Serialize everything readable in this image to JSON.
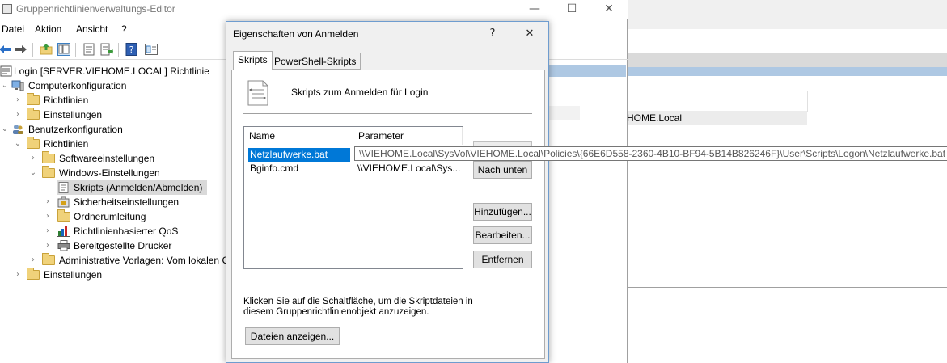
{
  "window": {
    "title": "Gruppenrichtlinienverwaltungs-Editor",
    "minimize": "—",
    "maximize": "☐",
    "close": "✕"
  },
  "menu": {
    "items": [
      "Datei",
      "Aktion",
      "Ansicht",
      "?"
    ]
  },
  "tree": {
    "items": [
      {
        "label": "Login [SERVER.VIEHOME.LOCAL] Richtlinie",
        "icon": "policy-icon"
      },
      {
        "label": "Computerkonfiguration",
        "icon": "computer-icon"
      },
      {
        "label": "Richtlinien",
        "icon": "folder-icon"
      },
      {
        "label": "Einstellungen",
        "icon": "folder-icon"
      },
      {
        "label": "Benutzerkonfiguration",
        "icon": "users-icon"
      },
      {
        "label": "Richtlinien",
        "icon": "folder-icon"
      },
      {
        "label": "Softwareeinstellungen",
        "icon": "folder-icon"
      },
      {
        "label": "Windows-Einstellungen",
        "icon": "folder-icon"
      },
      {
        "label": "Skripts (Anmelden/Abmelden)",
        "icon": "script-icon"
      },
      {
        "label": "Sicherheitseinstellungen",
        "icon": "security-icon"
      },
      {
        "label": "Ordnerumleitung",
        "icon": "folder-icon"
      },
      {
        "label": "Richtlinienbasierter QoS",
        "icon": "chart-icon"
      },
      {
        "label": "Bereitgestellte Drucker",
        "icon": "printer-icon"
      },
      {
        "label": "Administrative Vorlagen: Vom lokalen C",
        "icon": "folder-icon"
      },
      {
        "label": "Einstellungen",
        "icon": "folder-icon"
      }
    ]
  },
  "right_pane": {
    "value": "HOME.Local"
  },
  "dialog": {
    "title": "Eigenschaften von Anmelden",
    "help": "?",
    "close": "✕",
    "tabs": [
      "Skripts",
      "PowerShell-Skripts"
    ],
    "heading": "Skripts zum Anmelden für Login",
    "columns": [
      "Name",
      "Parameter"
    ],
    "rows": [
      {
        "name": "Netzlaufwerke.bat",
        "parameter": ""
      },
      {
        "name": "Bginfo.cmd",
        "parameter": "\\\\VIEHOME.Local\\Sys..."
      }
    ],
    "tooltip": "\\\\VIEHOME.Local\\SysVol\\VIEHOME.Local\\Policies\\{66E6D558-2360-4B10-BF94-5B14B826246F}\\User\\Scripts\\Logon\\Netzlaufwerke.bat",
    "buttons": {
      "down": "Nach unten",
      "add": "Hinzufügen...",
      "edit": "Bearbeiten...",
      "remove": "Entfernen",
      "show_files": "Dateien anzeigen..."
    },
    "info_text_line1": "Klicken Sie auf die Schaltfläche, um die Skriptdateien in",
    "info_text_line2": "diesem Gruppenrichtlinienobjekt anzuzeigen."
  },
  "colors": {
    "selection": "#0078d7",
    "dialog_border": "#6e9ccf",
    "tree_selected": "#d9d9d9"
  }
}
